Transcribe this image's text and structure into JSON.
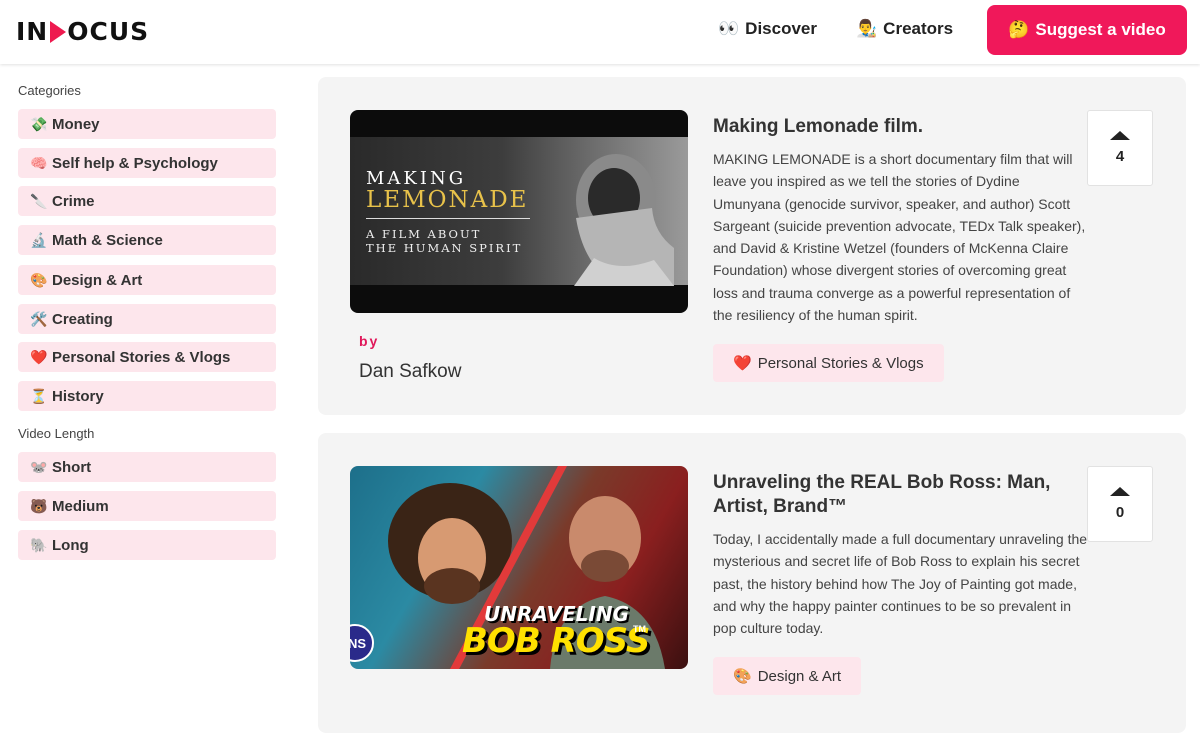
{
  "header": {
    "logo_left": "IN",
    "logo_right": "OCUS",
    "nav": [
      {
        "icon": "👀",
        "label": "Discover"
      },
      {
        "icon": "👨‍🎨",
        "label": "Creators"
      }
    ],
    "suggest": {
      "icon": "🤔",
      "label": "Suggest a video"
    }
  },
  "sidebar": {
    "categories_title": "Categories",
    "categories": [
      {
        "icon": "💸",
        "label": "Money"
      },
      {
        "icon": "🧠",
        "label": "Self help & Psychology"
      },
      {
        "icon": "🔪",
        "label": "Crime"
      },
      {
        "icon": "🔬",
        "label": "Math & Science"
      },
      {
        "icon": "🎨",
        "label": "Design & Art"
      },
      {
        "icon": "🛠️",
        "label": "Creating"
      },
      {
        "icon": "❤️",
        "label": "Personal Stories & Vlogs"
      },
      {
        "icon": "⏳",
        "label": "History"
      }
    ],
    "length_title": "Video Length",
    "lengths": [
      {
        "icon": "🐭",
        "label": "Short"
      },
      {
        "icon": "🐻",
        "label": "Medium"
      },
      {
        "icon": "🐘",
        "label": "Long"
      }
    ]
  },
  "videos": [
    {
      "thumb": {
        "line1": "MAKING",
        "line2": "LEMONADE",
        "line3": "A FILM ABOUT",
        "line4": "THE HUMAN SPIRIT"
      },
      "by_label": "by",
      "creator": "Dan Safkow",
      "title": "Making Lemonade film.",
      "description": "MAKING LEMONADE is a short documentary film that will leave you inspired as we tell the stories of Dydine Umunyana (genocide survivor, speaker, and author) Scott Sargeant (suicide prevention advocate, TEDx Talk speaker), and David & Kristine Wetzel (founders of McKenna Claire Foundation) whose divergent stories of overcoming great loss and trauma converge as a powerful representation of the resiliency of the human spirit.",
      "votes": "4",
      "tag": {
        "icon": "❤️",
        "label": "Personal Stories & Vlogs"
      }
    },
    {
      "thumb": {
        "line1": "UNRAVELING",
        "line2": "BOB ROSS",
        "tm": "TM",
        "badge": "NS"
      },
      "title": "Unraveling the REAL Bob Ross: Man, Artist, Brand™",
      "description": "Today, I accidentally made a full documentary unraveling the mysterious and secret life of Bob Ross to explain his secret past, the history behind how The Joy of Painting got made, and why the happy painter continues to be so prevalent in pop culture today.",
      "votes": "0",
      "tag": {
        "icon": "🎨",
        "label": "Design & Art"
      }
    }
  ]
}
